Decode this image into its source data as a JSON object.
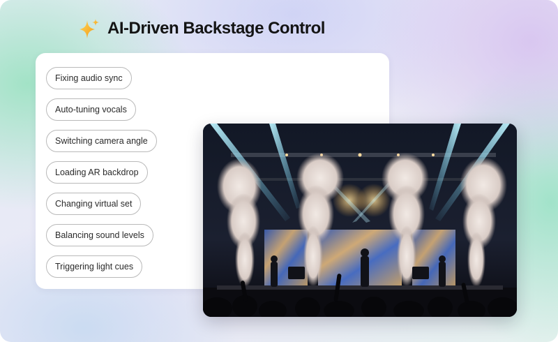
{
  "header": {
    "title": "AI-Driven Backstage Control",
    "icon": "sparkle-icon"
  },
  "tasks": [
    {
      "label": "Fixing audio sync"
    },
    {
      "label": "Auto-tuning vocals"
    },
    {
      "label": "Switching camera angle"
    },
    {
      "label": "Loading AR backdrop"
    },
    {
      "label": "Changing virtual set"
    },
    {
      "label": "Balancing sound levels"
    },
    {
      "label": "Triggering light cues"
    }
  ],
  "colors": {
    "sparkle_gold": "#f4b323",
    "title_text": "#141414",
    "chip_border": "#b9b9b9"
  }
}
